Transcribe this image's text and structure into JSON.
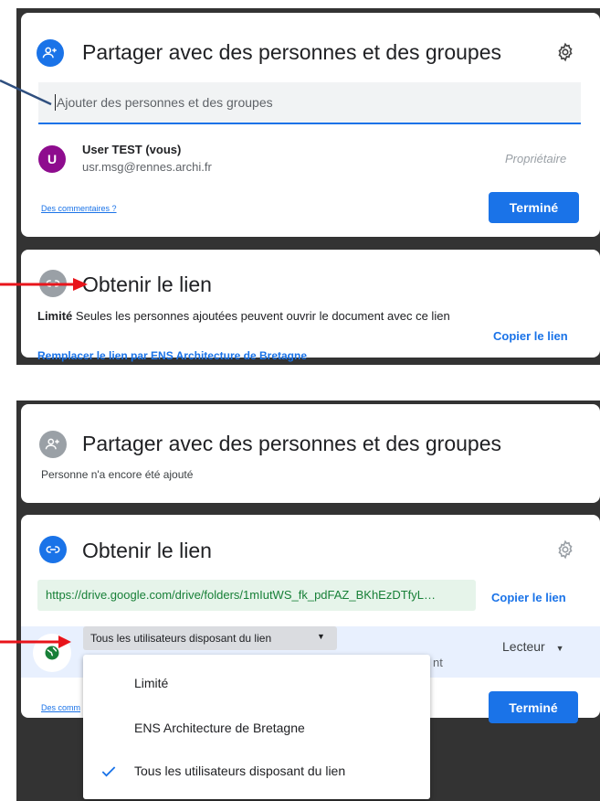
{
  "top_share": {
    "title": "Partager avec des personnes et des groupes",
    "input_placeholder": "Ajouter des personnes et des groupes",
    "user": {
      "initial": "U",
      "name": "User TEST (vous)",
      "email": "usr.msg@rennes.archi.fr",
      "role": "Propriétaire"
    },
    "feedback_link": "Des commentaires ?",
    "done_button": "Terminé"
  },
  "top_link": {
    "title": "Obtenir le lien",
    "access_label": "Limité",
    "access_desc": "Seules les personnes ajoutées peuvent ouvrir le document avec ce lien",
    "replace_link": "Remplacer le lien par ENS Architecture de Bretagne",
    "copy_link": "Copier le lien"
  },
  "bottom_share": {
    "title": "Partager avec des personnes et des groupes",
    "subtitle": "Personne n'a encore été ajouté"
  },
  "bottom_link": {
    "title": "Obtenir le lien",
    "url": "https://drive.google.com/drive/folders/1mIutWS_fk_pdFAZ_BKhEzDTfyL…",
    "copy_link": "Copier le lien",
    "access_selected": "Tous les utilisateurs disposant du lien",
    "hidden_text_fragment": "nt",
    "role": "Lecteur",
    "feedback_link": "Des comm",
    "done_button": "Terminé",
    "dropdown_options": [
      {
        "label": "Limité",
        "checked": false
      },
      {
        "label": "ENS Architecture de Bretagne",
        "checked": false
      },
      {
        "label": "Tous les utilisateurs disposant du lien",
        "checked": true
      }
    ]
  },
  "colors": {
    "accent": "#1a73e8",
    "avatar": "#8e0c8e",
    "link_field_bg": "#e6f4ea",
    "link_field_text": "#188038",
    "row_highlight": "#e8f0fe",
    "annotation_arrow": "#e8141b",
    "annotation_pointer": "#2f4f7f"
  }
}
